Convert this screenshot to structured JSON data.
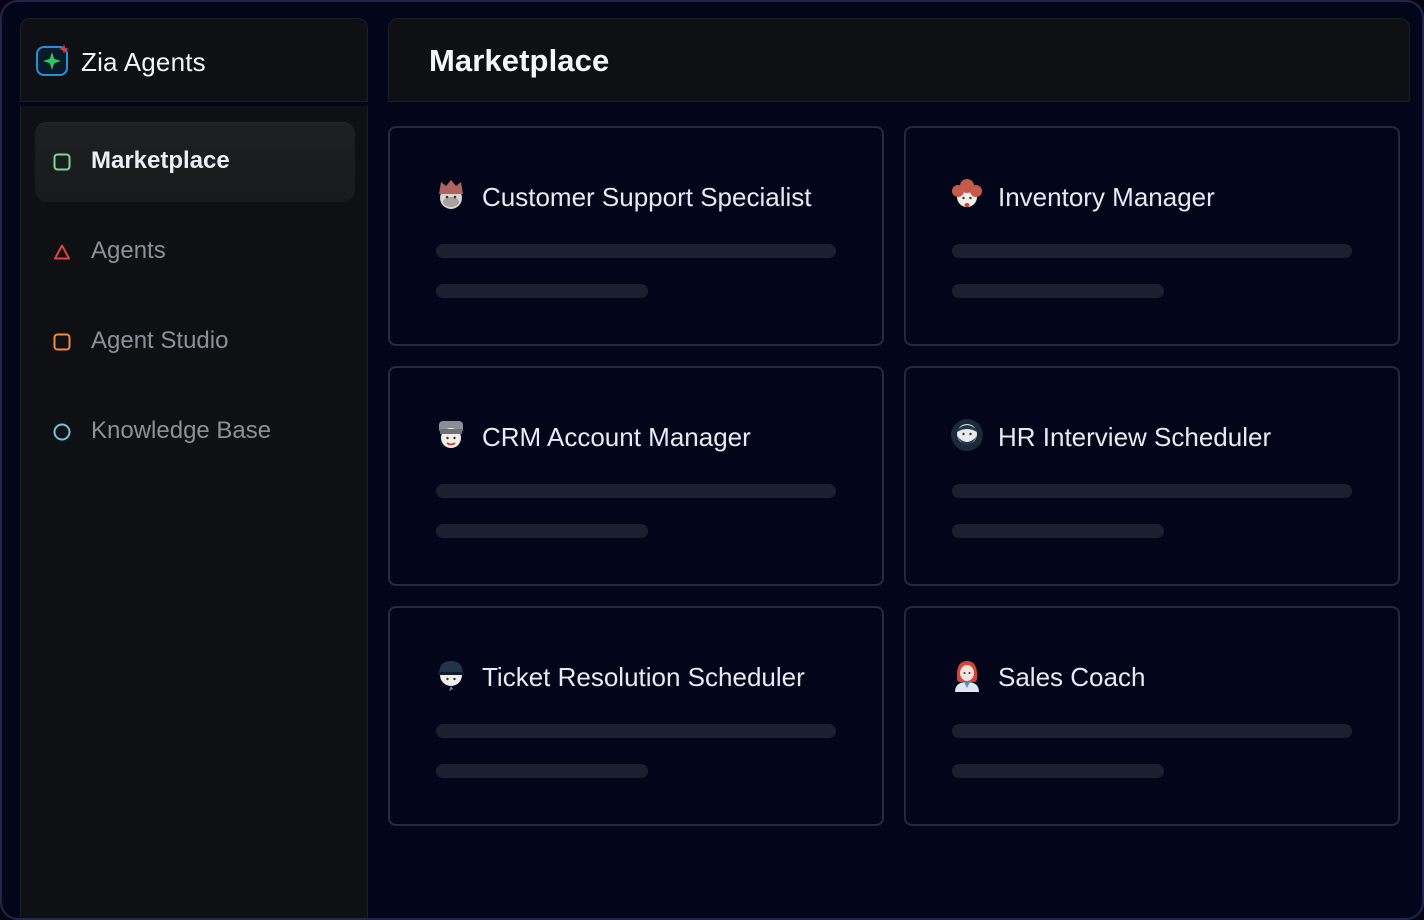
{
  "app": {
    "name": "Zia Agents",
    "logo_icon": "sparkle-logo-icon"
  },
  "header": {
    "title": "Marketplace"
  },
  "sidebar": {
    "items": [
      {
        "label": "Marketplace",
        "icon": "square-icon",
        "color": "#7fd88f",
        "active": true
      },
      {
        "label": "Agents",
        "icon": "triangle-icon",
        "color": "#e0453f",
        "active": false
      },
      {
        "label": "Agent Studio",
        "icon": "square-icon",
        "color": "#f08a3c",
        "active": false
      },
      {
        "label": "Knowledge Base",
        "icon": "circle-icon",
        "color": "#6cc6e0",
        "active": false
      }
    ]
  },
  "agents": [
    {
      "name": "Customer Support Specialist",
      "avatar": "support-agent-avatar-icon"
    },
    {
      "name": "Inventory Manager",
      "avatar": "curly-hair-avatar-icon"
    },
    {
      "name": "CRM Account Manager",
      "avatar": "chef-hat-avatar-icon"
    },
    {
      "name": "HR Interview Scheduler",
      "avatar": "bearded-avatar-icon"
    },
    {
      "name": "Ticket Resolution Scheduler",
      "avatar": "cap-avatar-icon"
    },
    {
      "name": "Sales Coach",
      "avatar": "red-hair-avatar-icon"
    }
  ],
  "colors": {
    "background": "#03051a",
    "sidebar": "#0f1013",
    "card_border": "#272a3e",
    "skeleton": "#1c1f30"
  }
}
